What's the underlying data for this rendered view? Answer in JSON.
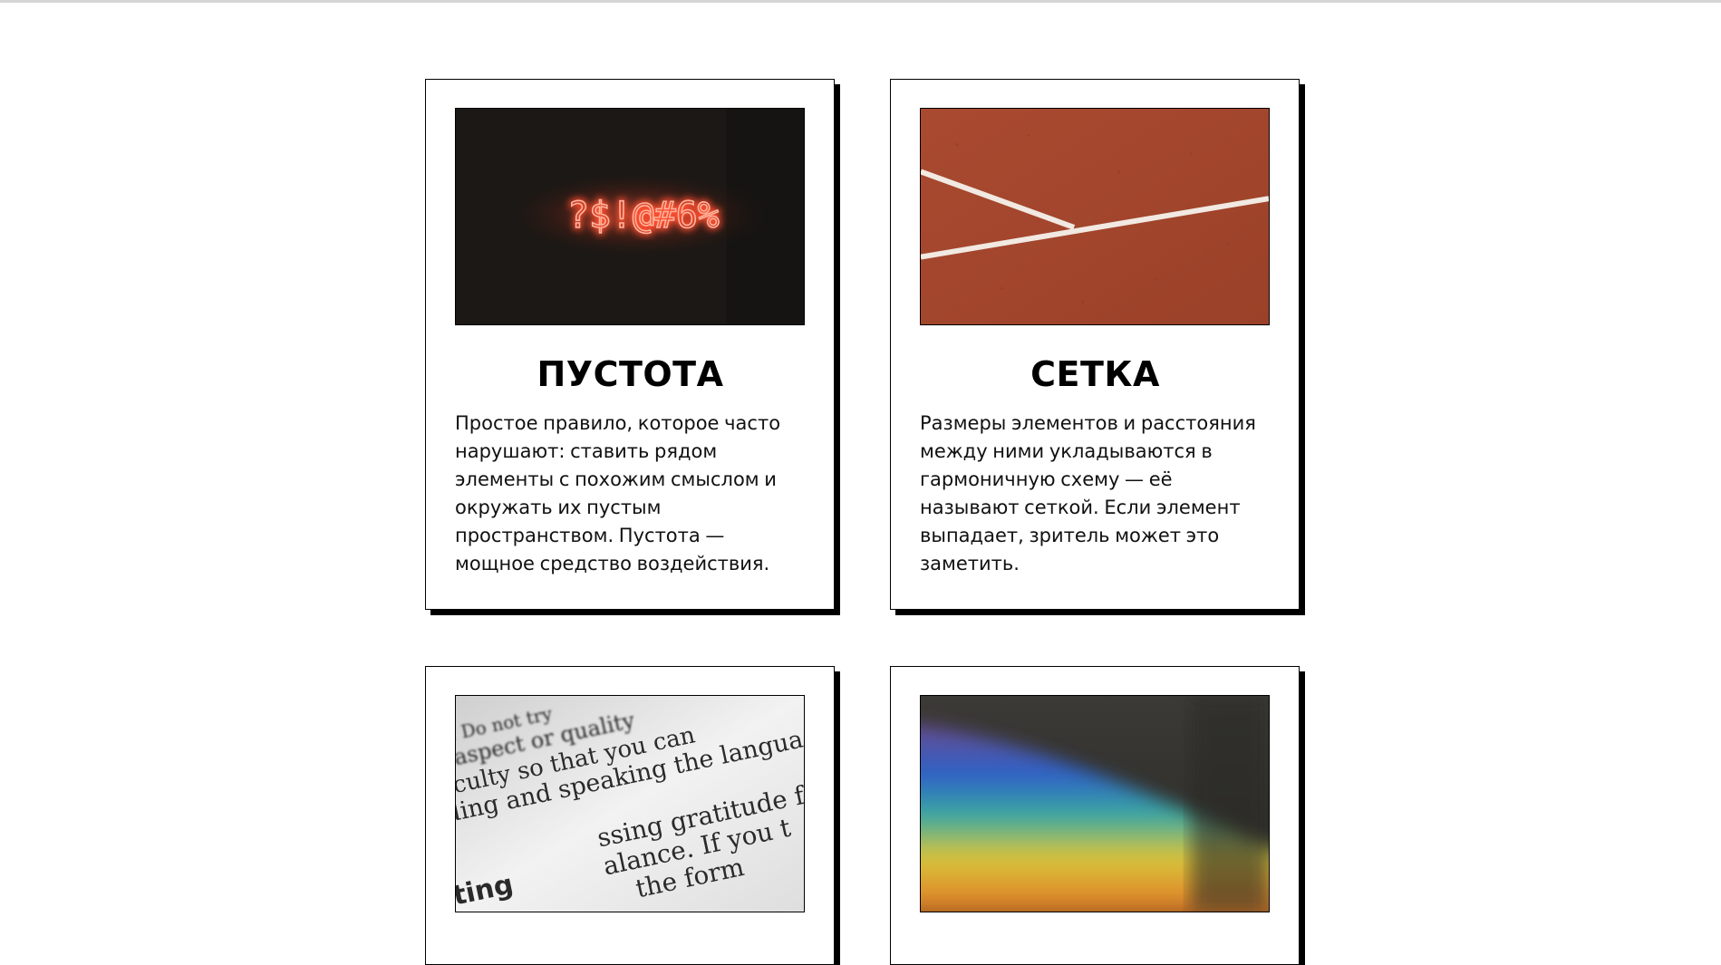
{
  "cards": [
    {
      "title": "ПУСТОТА",
      "text": "Простое правило, которое часто нарушают: ставить рядом элементы с похожим смыслом и окружать их пустым пространством. Пустота — мощное средство воздействия.",
      "image": {
        "neon_text": "?$!@#6%",
        "icon": "neon-sign-image"
      }
    },
    {
      "title": "СЕТКА",
      "text": "Размеры элементов и расстояния между ними укладываются в гармоничную схему — её называют сеткой. Если элемент выпадает, зритель может это заметить.",
      "image": {
        "icon": "clay-court-lines-image"
      }
    },
    {
      "title": "",
      "text": "",
      "image": {
        "icon": "book-text-closeup-image",
        "text_lines": [
          "ke. Do not try",
          "h aspect or quality",
          "aculty so that you can",
          "ding and speaking the langua",
          "ssing gratitude for",
          "alance. If you t",
          "the form",
          "ting"
        ]
      }
    },
    {
      "title": "",
      "text": "",
      "image": {
        "icon": "rainbow-light-image"
      }
    }
  ],
  "colors": {
    "card_border": "#000000",
    "card_shadow": "#000000",
    "page_bg": "#ffffff",
    "neon": "#ff6a4a",
    "clay": "#a3482f"
  }
}
